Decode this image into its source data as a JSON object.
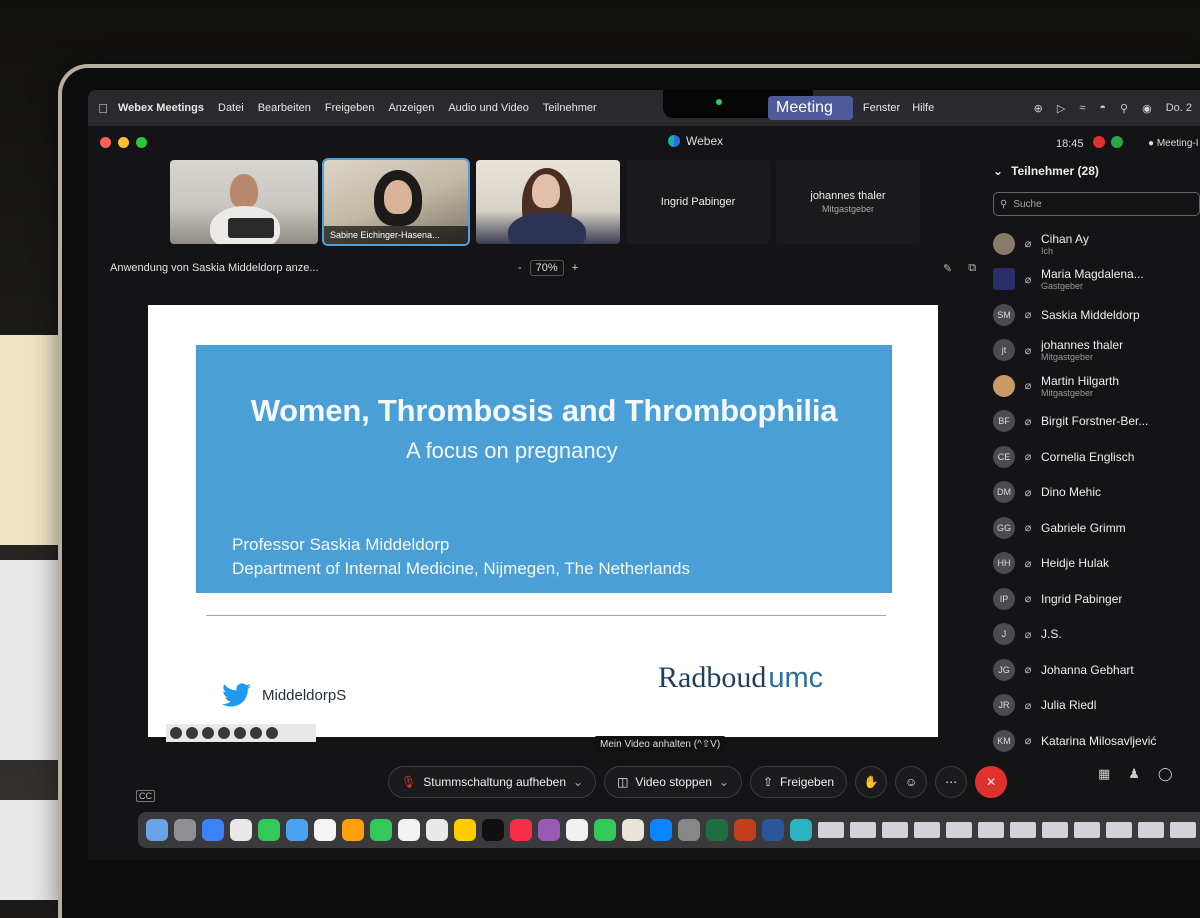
{
  "menubar": {
    "app": "Webex Meetings",
    "items": [
      "Datei",
      "Bearbeiten",
      "Freigeben",
      "Anzeigen",
      "Audio und Video",
      "Teilnehmer"
    ],
    "right_items": [
      "Meeting",
      "Fenster",
      "Hilfe"
    ],
    "date": "Do. 2"
  },
  "window": {
    "title": "Webex",
    "time": "18:45",
    "meeting_label": "Meeting-I"
  },
  "thumbnails": {
    "video2_name": "Sabine Eichinger-Hasena...",
    "tile4_name": "Ingrid Pabinger",
    "tile5_name": "johannes thaler",
    "tile5_role": "Mitgastgeber"
  },
  "share": {
    "label": "Anwendung von Saskia Middeldorp anze...",
    "zoom": "70%",
    "zoom_minus": "-",
    "zoom_plus": "+"
  },
  "slide": {
    "title": "Women, Thrombosis and Thrombophilia",
    "subtitle": "A focus on pregnancy",
    "author": "Professor Saskia Middeldorp",
    "department": "Department of Internal Medicine, Nijmegen, The Netherlands",
    "twitter": "MiddeldorpS",
    "logo_main": "Radboud",
    "logo_suffix": "umc"
  },
  "tooltip": "Mein Video anhalten (^⇧V)",
  "toolbar": {
    "mute": "Stummschaltung aufheben",
    "video": "Video stoppen",
    "share": "Freigeben",
    "cc": "CC"
  },
  "panel": {
    "title": "Teilnehmer (28)",
    "search_placeholder": "Suche",
    "participants": [
      {
        "initials": "",
        "name": "Cihan Ay",
        "role": "Ich"
      },
      {
        "initials": "",
        "name": "Maria Magdalena...",
        "role": "Gastgeber"
      },
      {
        "initials": "SM",
        "name": "Saskia Middeldorp",
        "role": ""
      },
      {
        "initials": "jt",
        "name": "johannes thaler",
        "role": "Mitgastgeber"
      },
      {
        "initials": "",
        "name": "Martin Hilgarth",
        "role": "Mitgastgeber"
      },
      {
        "initials": "BF",
        "name": "Birgit Forstner-Ber...",
        "role": ""
      },
      {
        "initials": "CE",
        "name": "Cornelia Englisch",
        "role": ""
      },
      {
        "initials": "DM",
        "name": "Dino Mehic",
        "role": ""
      },
      {
        "initials": "GG",
        "name": "Gabriele Grimm",
        "role": ""
      },
      {
        "initials": "HH",
        "name": "Heidje Hulak",
        "role": ""
      },
      {
        "initials": "IP",
        "name": "Ingrid Pabinger",
        "role": ""
      },
      {
        "initials": "J",
        "name": "J.S.",
        "role": ""
      },
      {
        "initials": "JG",
        "name": "Johanna Gebhart",
        "role": ""
      },
      {
        "initials": "JR",
        "name": "Julia Riedl",
        "role": ""
      },
      {
        "initials": "KM",
        "name": "Katarina Milosavljević",
        "role": ""
      }
    ]
  },
  "colors": {
    "slide_blue": "#4a9fd6",
    "end_call": "#e0312e",
    "menu_highlight": "#4d5b9a",
    "active_speaker": "#4aa3e0"
  }
}
